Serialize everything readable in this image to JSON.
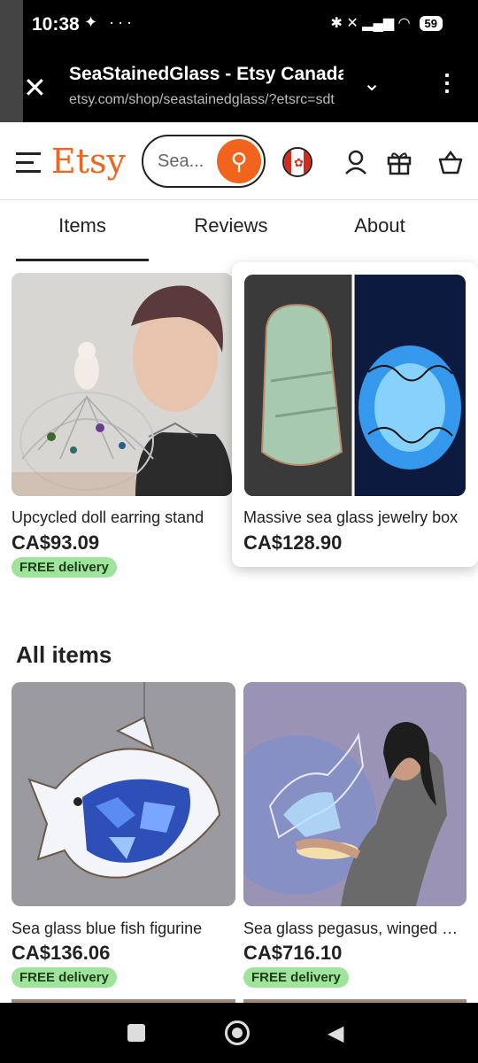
{
  "status_bar": {
    "time": "10:38",
    "left_icons": "✦ ···",
    "right_icons": "✱ ✕ ▂▄▆ ◠",
    "battery": "59"
  },
  "browser": {
    "title": "SeaStainedGlass - Etsy Canada",
    "url": "etsy.com/shop/seastainedglass/?etsrc=sdt",
    "close_icon": "close-icon",
    "expand_icon": "chevron-down-icon",
    "menu_icon": "more-vert-icon"
  },
  "header": {
    "logo": "Etsy",
    "search_placeholder": "Sea...",
    "icons": [
      "menu-icon",
      "search-icon",
      "canada-flag-icon",
      "account-icon",
      "gift-icon",
      "cart-icon"
    ]
  },
  "tabs": [
    {
      "label": "Items",
      "active": true
    },
    {
      "label": "Reviews",
      "active": false
    },
    {
      "label": "About",
      "active": false
    }
  ],
  "featured": [
    {
      "name": "Upcycled doll earring stand",
      "price": "CA$93.09",
      "badge": "FREE delivery"
    },
    {
      "name": "Massive sea glass jewelry box",
      "price": "CA$128.90",
      "badge": ""
    }
  ],
  "all_items_title": "All items",
  "items": [
    {
      "name": "Sea glass blue fish figurine",
      "price": "CA$136.06",
      "badge": "FREE delivery"
    },
    {
      "name": "Sea glass pegasus, winged horse",
      "price": "CA$716.10",
      "badge": "FREE delivery"
    }
  ],
  "colors": {
    "accent": "#f1641e",
    "badge_bg": "#9ee59b"
  },
  "nav_bar": [
    "recents-icon",
    "home-icon",
    "back-icon"
  ]
}
